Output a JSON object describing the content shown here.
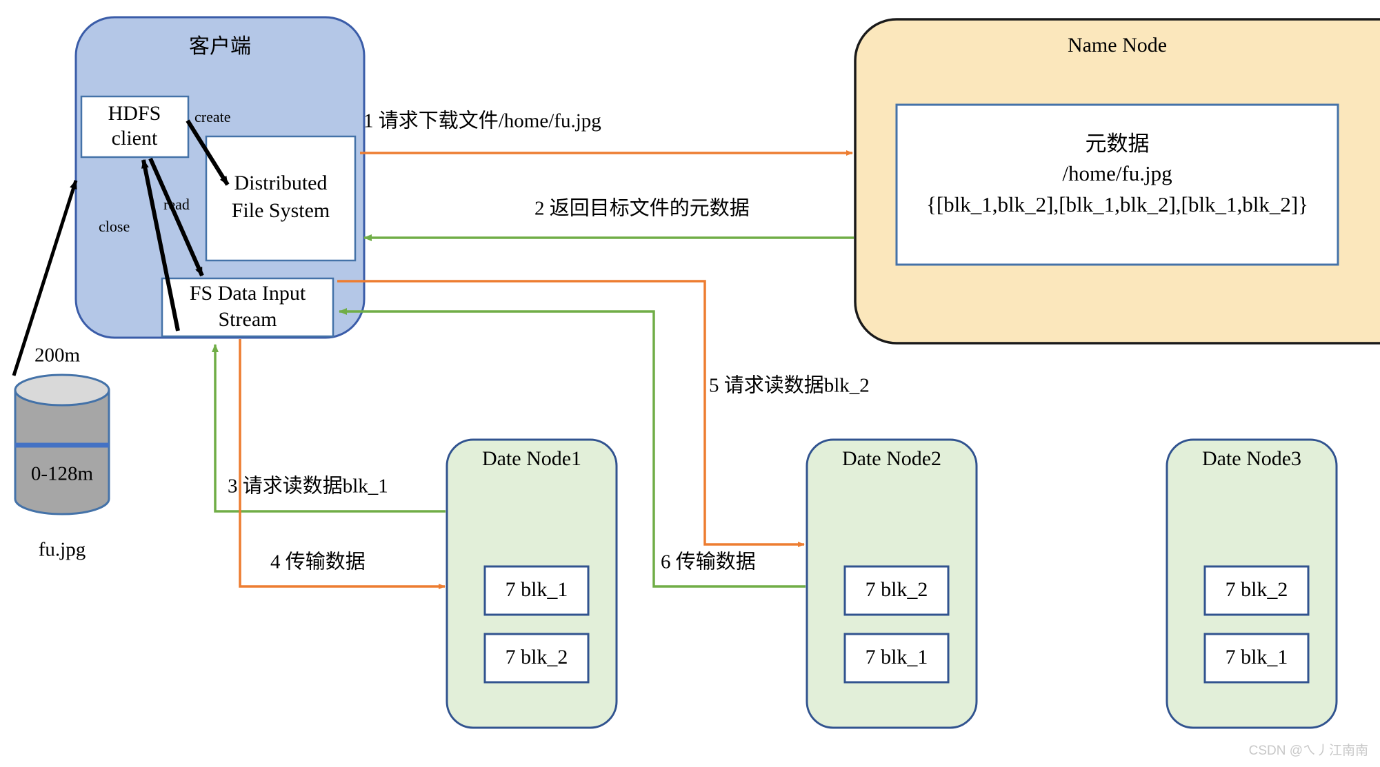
{
  "colors": {
    "client_fill": "#b4c7e7",
    "client_stroke": "#3a5ca8",
    "namenode_fill": "#fbe7bc",
    "namenode_stroke": "#1a1a1a",
    "datanode_fill": "#e2efd9",
    "datanode_stroke": "#31538f",
    "inner_box_fill": "#ffffff",
    "inner_box_stroke": "#4472a8",
    "orange": "#ed7d31",
    "green": "#70ad47",
    "black": "#000000",
    "disk_fill": "#a6a6a6",
    "disk_top_fill": "#d9d9d9",
    "disk_stroke": "#4472a8",
    "disk_divider": "#4472c4",
    "watermark": "#c8c8c8",
    "background": "#ffffff"
  },
  "client": {
    "title": "客户端",
    "hdfs_client": {
      "line1": "HDFS",
      "line2": "client"
    },
    "dfs": {
      "line1": "Distributed",
      "line2": "File System"
    },
    "fs_input": {
      "line1": "FS Data Input",
      "line2": "Stream"
    },
    "op_create": "create",
    "op_read": "read",
    "op_close": "close"
  },
  "namenode": {
    "title": "Name Node",
    "metadata": {
      "line1": "元数据",
      "line2": "/home/fu.jpg",
      "line3": "{[blk_1,blk_2],[blk_1,blk_2],[blk_1,blk_2]}"
    }
  },
  "disk": {
    "size_label": "200m",
    "block_label": "0-128m",
    "file_label": "fu.jpg"
  },
  "datanodes": [
    {
      "title": "Date Node1",
      "blocks": [
        "7 blk_1",
        "7 blk_2"
      ]
    },
    {
      "title": "Date Node2",
      "blocks": [
        "7 blk_2",
        "7 blk_1"
      ]
    },
    {
      "title": "Date Node3",
      "blocks": [
        "7 blk_2",
        "7 blk_1"
      ]
    }
  ],
  "steps": [
    {
      "id": 1,
      "label": "1 请求下载文件/home/fu.jpg",
      "color": "#ed7d31"
    },
    {
      "id": 2,
      "label": "2 返回目标文件的元数据",
      "color": "#70ad47"
    },
    {
      "id": 3,
      "label": "3 请求读数据blk_1",
      "color": "#70ad47"
    },
    {
      "id": 4,
      "label": "4 传输数据",
      "color": "#ed7d31"
    },
    {
      "id": 5,
      "label": "5 请求读数据blk_2",
      "color": "#ed7d31"
    },
    {
      "id": 6,
      "label": "6 传输数据",
      "color": "#70ad47"
    }
  ],
  "watermark": "CSDN @ㄟ丿江南南"
}
